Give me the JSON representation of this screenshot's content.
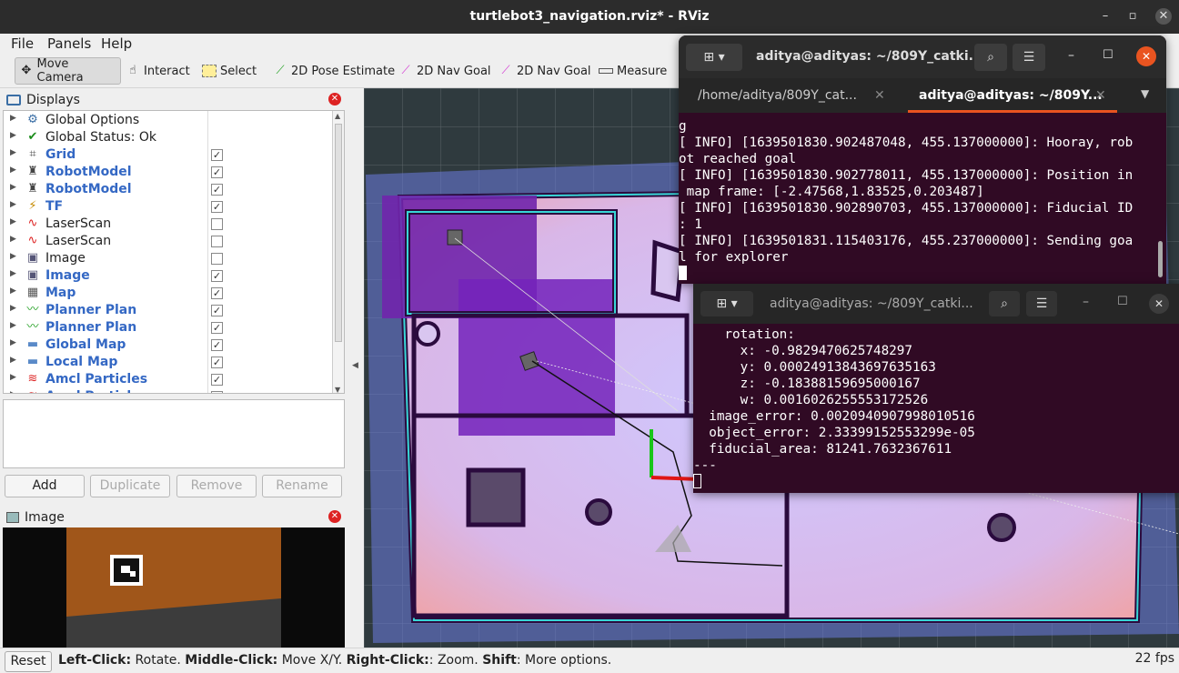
{
  "window": {
    "title": "turtlebot3_navigation.rviz* - RViz",
    "controls": [
      "–",
      "▫",
      "✕"
    ]
  },
  "menu": [
    "File",
    "Panels",
    "Help"
  ],
  "toolbar": {
    "move_camera": "Move Camera",
    "interact": "Interact",
    "select": "Select",
    "pose_estimate": "2D Pose Estimate",
    "nav_goal_1": "2D Nav Goal",
    "nav_goal_2": "2D Nav Goal",
    "measure": "Measure"
  },
  "displays_panel": {
    "title": "Displays",
    "items": [
      {
        "label": "Global Options",
        "icon": "gear-icon",
        "checkbox": null,
        "bold": false
      },
      {
        "label": "Global Status: Ok",
        "icon": "check-icon",
        "checkbox": null,
        "bold": false
      },
      {
        "label": "Grid",
        "icon": "grid-icon",
        "checkbox": true,
        "bold": true
      },
      {
        "label": "RobotModel",
        "icon": "robot-icon",
        "checkbox": true,
        "bold": true
      },
      {
        "label": "RobotModel",
        "icon": "robot-icon",
        "checkbox": true,
        "bold": true
      },
      {
        "label": "TF",
        "icon": "tf-icon",
        "checkbox": true,
        "bold": true
      },
      {
        "label": "LaserScan",
        "icon": "laser-icon",
        "checkbox": false,
        "bold": false
      },
      {
        "label": "LaserScan",
        "icon": "laser-icon",
        "checkbox": false,
        "bold": false
      },
      {
        "label": "Image",
        "icon": "image-icon",
        "checkbox": false,
        "bold": false
      },
      {
        "label": "Image",
        "icon": "image-icon",
        "checkbox": true,
        "bold": true
      },
      {
        "label": "Map",
        "icon": "map-icon",
        "checkbox": true,
        "bold": true
      },
      {
        "label": "Planner Plan",
        "icon": "path-icon",
        "checkbox": true,
        "bold": true
      },
      {
        "label": "Planner Plan",
        "icon": "path-icon",
        "checkbox": true,
        "bold": true
      },
      {
        "label": "Global Map",
        "icon": "folder-icon",
        "checkbox": true,
        "bold": true
      },
      {
        "label": "Local Map",
        "icon": "folder-icon",
        "checkbox": true,
        "bold": true
      },
      {
        "label": "Amcl Particles",
        "icon": "particles-icon",
        "checkbox": true,
        "bold": true
      },
      {
        "label": "Amcl Particles",
        "icon": "particles-icon",
        "checkbox": true,
        "bold": true
      }
    ],
    "buttons": {
      "add": "Add",
      "duplicate": "Duplicate",
      "remove": "Remove",
      "rename": "Rename"
    }
  },
  "image_panel": {
    "title": "Image"
  },
  "status_bar": {
    "reset": "Reset",
    "left_click": "Left-Click:",
    "left_click_action": " Rotate. ",
    "middle_click": "Middle-Click:",
    "middle_click_action": " Move X/Y. ",
    "right_click": "Right-Click:",
    "right_click_action": ": Zoom. ",
    "shift": "Shift",
    "shift_action": ": More options.",
    "fps": "22 fps"
  },
  "terminal_1": {
    "title": "aditya@adityas: ~/809Y_catki...",
    "tabs": [
      "/home/aditya/809Y_cat...",
      "aditya@adityas: ~/809Y..."
    ],
    "lines": [
      "g",
      "[ INFO] [1639501830.902487048, 455.137000000]: Hooray, rob",
      "ot reached goal",
      "[ INFO] [1639501830.902778011, 455.137000000]: Position in",
      " map frame: [-2.47568,1.83525,0.203487]",
      "[ INFO] [1639501830.902890703, 455.137000000]: Fiducial ID",
      ": 1",
      "[ INFO] [1639501831.115403176, 455.237000000]: Sending goa",
      "l for explorer"
    ]
  },
  "terminal_2": {
    "title": "aditya@adityas: ~/809Y_catki...",
    "lines": [
      "    rotation:",
      "      x: -0.9829470625748297",
      "      y: 0.00024913843697635163",
      "      z: -0.18388159695000167",
      "      w: 0.0016026255553172526",
      "  image_error: 0.0020940907998010516",
      "  object_error: 2.33399152553299e-05",
      "  fiducial_area: 81241.7632367611",
      "---"
    ]
  },
  "colors": {
    "terminal_bg": "#300a24",
    "accent": "#e95420",
    "link_blue": "#3468c4",
    "close_red": "#d22"
  }
}
